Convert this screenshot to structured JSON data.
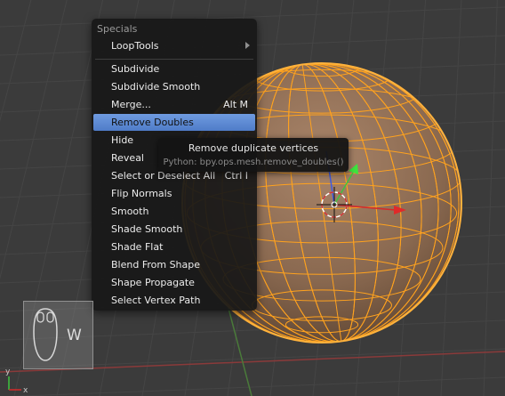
{
  "menu": {
    "title": "Specials",
    "items": [
      {
        "label": "LoopTools",
        "shortcut": "",
        "submenu": true
      },
      {
        "label": "Subdivide",
        "shortcut": ""
      },
      {
        "label": "Subdivide Smooth",
        "shortcut": ""
      },
      {
        "label": "Merge...",
        "shortcut": "Alt M"
      },
      {
        "label": "Remove Doubles",
        "shortcut": "",
        "highlighted": true
      },
      {
        "label": "Hide",
        "shortcut": ""
      },
      {
        "label": "Reveal",
        "shortcut": ""
      },
      {
        "label": "Select or Deselect All",
        "shortcut": "Ctrl I"
      },
      {
        "label": "Flip Normals",
        "shortcut": ""
      },
      {
        "label": "Smooth",
        "shortcut": ""
      },
      {
        "label": "Shade Smooth",
        "shortcut": ""
      },
      {
        "label": "Shade Flat",
        "shortcut": ""
      },
      {
        "label": "Blend From Shape",
        "shortcut": ""
      },
      {
        "label": "Shape Propagate",
        "shortcut": ""
      },
      {
        "label": "Select Vertex Path",
        "shortcut": ""
      }
    ]
  },
  "tooltip": {
    "description": "Remove duplicate vertices",
    "python": "Python: bpy.ops.mesh.remove_doubles()"
  },
  "key_hint": {
    "key": "W",
    "icon": "mouse-icon"
  },
  "axis_labels": {
    "x": "x",
    "y": "y"
  },
  "colors": {
    "viewport_bg": "#3b3b3b",
    "menu_bg": "#181818",
    "highlight": "#5a86d0",
    "mesh_wire": "#ffa21e",
    "mesh_fill": "#8c6a4c",
    "axis_x": "#d42a2a",
    "axis_y": "#3ec43e",
    "axis_z": "#3f5ae0"
  }
}
